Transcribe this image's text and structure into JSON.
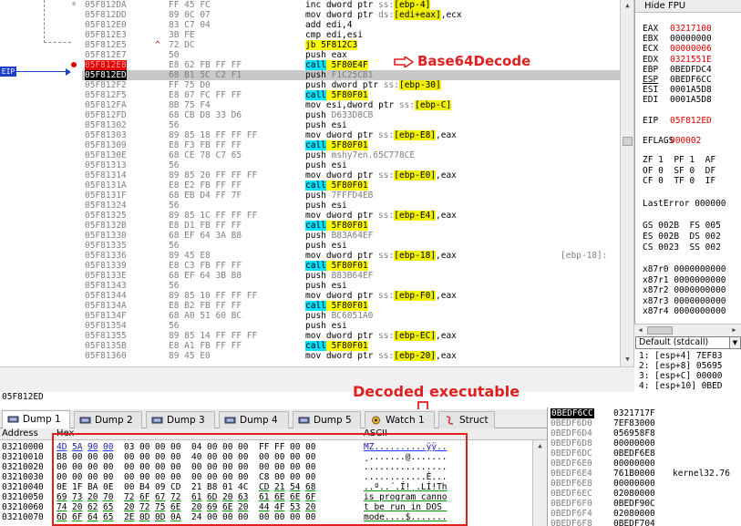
{
  "disasm": {
    "rows": [
      {
        "addr": "05F812DA",
        "bytes": "FF 45 FC",
        "ins": [
          [
            "inc dword ptr ",
            ""
          ],
          [
            "ss:",
            "seg"
          ],
          [
            "[ebp-4]",
            "mem"
          ]
        ],
        "mark": "",
        "style": ""
      },
      {
        "addr": "05F812DD",
        "bytes": "89 0C 07",
        "ins": [
          [
            "mov dword ptr ",
            ""
          ],
          [
            "ds:",
            "seg"
          ],
          [
            "[edi+eax]",
            "mem"
          ],
          [
            ",ecx",
            ""
          ]
        ],
        "mark": "",
        "style": ""
      },
      {
        "addr": "05F812E0",
        "bytes": "83 C7 04",
        "ins": [
          [
            "add edi,4",
            ""
          ]
        ],
        "mark": "",
        "style": ""
      },
      {
        "addr": "05F812E3",
        "bytes": "3B FE",
        "ins": [
          [
            "cmp edi,esi",
            ""
          ]
        ],
        "mark": "",
        "style": ""
      },
      {
        "addr": "05F812E5",
        "bytes": "72 DC",
        "ins": [
          [
            "jb",
            "jmp"
          ],
          [
            " 5F812C3",
            "tgt"
          ]
        ],
        "mark": "^",
        "style": ""
      },
      {
        "addr": "05F812E7",
        "bytes": "50",
        "ins": [
          [
            "push eax",
            ""
          ]
        ],
        "mark": "",
        "style": ""
      },
      {
        "addr": "05F812E8",
        "bytes": "E8 62 FB FF FF",
        "ins": [
          [
            "call",
            "call"
          ],
          [
            " 5F80E4F",
            "tgt"
          ]
        ],
        "mark": "",
        "style": "red"
      },
      {
        "addr": "05F812ED",
        "bytes": "68 B1 5C C2 F1",
        "ins": [
          [
            "push ",
            ""
          ],
          [
            "F1C25CB1",
            "gray"
          ]
        ],
        "mark": "",
        "style": "black hl"
      },
      {
        "addr": "05F812F2",
        "bytes": "FF 75 D0",
        "ins": [
          [
            "push dword ptr ",
            ""
          ],
          [
            "ss:",
            "seg"
          ],
          [
            "[ebp-30]",
            "mem"
          ]
        ],
        "mark": "",
        "style": ""
      },
      {
        "addr": "05F812F5",
        "bytes": "E8 07 FC FF FF",
        "ins": [
          [
            "call",
            "call"
          ],
          [
            " 5F80F01",
            "tgt"
          ]
        ],
        "mark": "",
        "style": ""
      },
      {
        "addr": "05F812FA",
        "bytes": "8B 75 F4",
        "ins": [
          [
            "mov esi,dword ptr ",
            ""
          ],
          [
            "ss:",
            "seg"
          ],
          [
            "[ebp-C]",
            "mem"
          ]
        ],
        "mark": "",
        "style": ""
      },
      {
        "addr": "05F812FD",
        "bytes": "68 CB D8 33 D6",
        "ins": [
          [
            "push ",
            ""
          ],
          [
            "D633D8CB",
            "gray"
          ]
        ],
        "mark": "",
        "style": ""
      },
      {
        "addr": "05F81302",
        "bytes": "56",
        "ins": [
          [
            "push esi",
            ""
          ]
        ],
        "mark": "",
        "style": ""
      },
      {
        "addr": "05F81303",
        "bytes": "89 85 18 FF FF FF",
        "ins": [
          [
            "mov dword ptr ",
            ""
          ],
          [
            "ss:",
            "seg"
          ],
          [
            "[ebp-E8]",
            "mem"
          ],
          [
            ",eax",
            ""
          ]
        ],
        "mark": "",
        "style": ""
      },
      {
        "addr": "05F81309",
        "bytes": "E8 F3 FB FF FF",
        "ins": [
          [
            "call",
            "call"
          ],
          [
            " 5F80F01",
            "tgt"
          ]
        ],
        "mark": "",
        "style": ""
      },
      {
        "addr": "05F8130E",
        "bytes": "68 CE 78 C7 65",
        "ins": [
          [
            "push ",
            ""
          ],
          [
            "mshy7en.65C778CE",
            "gray"
          ]
        ],
        "mark": "",
        "style": ""
      },
      {
        "addr": "05F81313",
        "bytes": "56",
        "ins": [
          [
            "push esi",
            ""
          ]
        ],
        "mark": "",
        "style": ""
      },
      {
        "addr": "05F81314",
        "bytes": "89 85 20 FF FF FF",
        "ins": [
          [
            "mov dword ptr ",
            ""
          ],
          [
            "ss:",
            "seg"
          ],
          [
            "[ebp-E0]",
            "mem"
          ],
          [
            ",eax",
            ""
          ]
        ],
        "mark": "",
        "style": ""
      },
      {
        "addr": "05F8131A",
        "bytes": "E8 E2 FB FF FF",
        "ins": [
          [
            "call",
            "call"
          ],
          [
            " 5F80F01",
            "tgt"
          ]
        ],
        "mark": "",
        "style": ""
      },
      {
        "addr": "05F8131F",
        "bytes": "68 EB D4 FF 7F",
        "ins": [
          [
            "push ",
            ""
          ],
          [
            "7FFFD4EB",
            "gray"
          ]
        ],
        "mark": "",
        "style": ""
      },
      {
        "addr": "05F81324",
        "bytes": "56",
        "ins": [
          [
            "push esi",
            ""
          ]
        ],
        "mark": "",
        "style": ""
      },
      {
        "addr": "05F81325",
        "bytes": "89 85 1C FF FF FF",
        "ins": [
          [
            "mov dword ptr ",
            ""
          ],
          [
            "ss:",
            "seg"
          ],
          [
            "[ebp-E4]",
            "mem"
          ],
          [
            ",eax",
            ""
          ]
        ],
        "mark": "",
        "style": ""
      },
      {
        "addr": "05F8132B",
        "bytes": "E8 D1 FB FF FF",
        "ins": [
          [
            "call",
            "call"
          ],
          [
            " 5F80F01",
            "tgt"
          ]
        ],
        "mark": "",
        "style": ""
      },
      {
        "addr": "05F81330",
        "bytes": "68 EF 64 3A B8",
        "ins": [
          [
            "push ",
            ""
          ],
          [
            "B83A64EF",
            "gray"
          ]
        ],
        "mark": "",
        "style": ""
      },
      {
        "addr": "05F81335",
        "bytes": "56",
        "ins": [
          [
            "push esi",
            ""
          ]
        ],
        "mark": "",
        "style": ""
      },
      {
        "addr": "05F81336",
        "bytes": "89 45 E8",
        "ins": [
          [
            "mov dword ptr ",
            ""
          ],
          [
            "ss:",
            "seg"
          ],
          [
            "[ebp-18]",
            "mem"
          ],
          [
            ",eax",
            ""
          ]
        ],
        "mark": "",
        "style": "",
        "cmt": "[ebp-18]:"
      },
      {
        "addr": "05F81339",
        "bytes": "E8 C3 FB FF FF",
        "ins": [
          [
            "call",
            "call"
          ],
          [
            " 5F80F01",
            "tgt"
          ]
        ],
        "mark": "",
        "style": ""
      },
      {
        "addr": "05F8133E",
        "bytes": "68 EF 64 3B B8",
        "ins": [
          [
            "push ",
            ""
          ],
          [
            "B83B64EF",
            "gray"
          ]
        ],
        "mark": "",
        "style": ""
      },
      {
        "addr": "05F81343",
        "bytes": "56",
        "ins": [
          [
            "push esi",
            ""
          ]
        ],
        "mark": "",
        "style": ""
      },
      {
        "addr": "05F81344",
        "bytes": "89 85 10 FF FF FF",
        "ins": [
          [
            "mov dword ptr ",
            ""
          ],
          [
            "ss:",
            "seg"
          ],
          [
            "[ebp-F0]",
            "mem"
          ],
          [
            ",eax",
            ""
          ]
        ],
        "mark": "",
        "style": ""
      },
      {
        "addr": "05F8134A",
        "bytes": "E8 B2 FB FF FF",
        "ins": [
          [
            "call",
            "call"
          ],
          [
            " 5F80F01",
            "tgt"
          ]
        ],
        "mark": "",
        "style": ""
      },
      {
        "addr": "05F8134F",
        "bytes": "68 A0 51 60 BC",
        "ins": [
          [
            "push ",
            ""
          ],
          [
            "BC6051A0",
            "gray"
          ]
        ],
        "mark": "",
        "style": ""
      },
      {
        "addr": "05F81354",
        "bytes": "56",
        "ins": [
          [
            "push esi",
            ""
          ]
        ],
        "mark": "",
        "style": ""
      },
      {
        "addr": "05F81355",
        "bytes": "89 85 14 FF FF FF",
        "ins": [
          [
            "mov dword ptr ",
            ""
          ],
          [
            "ss:",
            "seg"
          ],
          [
            "[ebp-EC]",
            "mem"
          ],
          [
            ",eax",
            ""
          ]
        ],
        "mark": "",
        "style": ""
      },
      {
        "addr": "05F8135B",
        "bytes": "E8 A1 FB FF FF",
        "ins": [
          [
            "call",
            "call"
          ],
          [
            " 5F80F01",
            "tgt"
          ]
        ],
        "mark": "",
        "style": ""
      },
      {
        "addr": "05F81360",
        "bytes": "89 45 E0",
        "ins": [
          [
            "mov dword ptr ",
            ""
          ],
          [
            "ss:",
            "seg"
          ],
          [
            "[ebp-20]",
            "mem"
          ],
          [
            ",eax",
            ""
          ]
        ],
        "mark": "",
        "style": ""
      }
    ],
    "eip_label": "EIP",
    "annotation_base64": "Base64Decode"
  },
  "registers": {
    "header": "Hide FPU",
    "items": [
      {
        "name": "EAX",
        "value": "03217100",
        "red": true
      },
      {
        "name": "EBX",
        "value": "00000000",
        "red": false
      },
      {
        "name": "ECX",
        "value": "00000006",
        "red": true
      },
      {
        "name": "EDX",
        "value": "0321551E",
        "red": true
      },
      {
        "name": "EBP",
        "value": "0BEDFDC4",
        "red": false
      },
      {
        "name": "ESP",
        "value": "0BEDF6CC",
        "red": false,
        "ul": true
      },
      {
        "name": "ESI",
        "value": "0001A5D8",
        "red": false
      },
      {
        "name": "EDI",
        "value": "0001A5D8",
        "red": false
      },
      {
        "name": "",
        "value": "",
        "red": false
      },
      {
        "name": "EIP",
        "value": "05F812ED",
        "red": true
      },
      {
        "name": "",
        "value": "",
        "red": false
      },
      {
        "name": "EFLAGS",
        "value": "000002",
        "red": true
      }
    ],
    "flags": [
      "ZF 1  PF 1  AF",
      "OF 0  SF 0  DF",
      "CF 0  TF 0  IF"
    ],
    "lasterror": "LastError 000000",
    "segments": [
      "GS 002B  FS 005",
      "ES 002B  DS 002",
      "CS 0023  SS 002"
    ],
    "fpu": [
      "x87r0 0000000000",
      "x87r1 0000000000",
      "x87r2 0000000000",
      "x87r3 0000000000",
      "x87r4 0000000000"
    ]
  },
  "callconv": {
    "selected": "Default (stdcall)"
  },
  "stack_args": [
    "1: [esp+4] 7EF83",
    "2: [esp+8] 05695",
    "3: [esp+C] 00000",
    "4: [esp+10] 0BED"
  ],
  "status": {
    "text": "05F812ED"
  },
  "annotation_decoded": "Decoded executable",
  "dump": {
    "tabs": [
      {
        "label": "Dump 1",
        "active": true
      },
      {
        "label": "Dump 2",
        "active": false
      },
      {
        "label": "Dump 3",
        "active": false
      },
      {
        "label": "Dump 4",
        "active": false
      },
      {
        "label": "Dump 5",
        "active": false
      },
      {
        "label": "Watch 1",
        "active": false
      },
      {
        "label": "Struct",
        "active": false
      }
    ],
    "headers": {
      "address": "Address",
      "hex": "Hex",
      "ascii": "ASCII"
    },
    "rows": [
      {
        "addr": "03210000",
        "hex": [
          "4D",
          "5A",
          "90",
          "00",
          "03",
          "00",
          "00",
          "00",
          "04",
          "00",
          "00",
          "00",
          "FF",
          "FF",
          "00",
          "00"
        ],
        "ascii": "MZ..........ÿÿ.."
      },
      {
        "addr": "03210010",
        "hex": [
          "B8",
          "00",
          "00",
          "00",
          "00",
          "00",
          "00",
          "00",
          "40",
          "00",
          "00",
          "00",
          "00",
          "00",
          "00",
          "00"
        ],
        "ascii": "¸.......@......."
      },
      {
        "addr": "03210020",
        "hex": [
          "00",
          "00",
          "00",
          "00",
          "00",
          "00",
          "00",
          "00",
          "00",
          "00",
          "00",
          "00",
          "00",
          "00",
          "00",
          "00"
        ],
        "ascii": "................"
      },
      {
        "addr": "03210030",
        "hex": [
          "00",
          "00",
          "00",
          "00",
          "00",
          "00",
          "00",
          "00",
          "00",
          "00",
          "00",
          "00",
          "C8",
          "00",
          "00",
          "00"
        ],
        "ascii": "............È..."
      },
      {
        "addr": "03210040",
        "hex": [
          "0E",
          "1F",
          "BA",
          "0E",
          "00",
          "B4",
          "09",
          "CD",
          "21",
          "B8",
          "01",
          "4C",
          "CD",
          "21",
          "54",
          "68"
        ],
        "ascii": "..º..´.Í!¸.LÍ!Th"
      },
      {
        "addr": "03210050",
        "hex": [
          "69",
          "73",
          "20",
          "70",
          "72",
          "6F",
          "67",
          "72",
          "61",
          "6D",
          "20",
          "63",
          "61",
          "6E",
          "6E",
          "6F"
        ],
        "ascii": "is program canno"
      },
      {
        "addr": "03210060",
        "hex": [
          "74",
          "20",
          "62",
          "65",
          "20",
          "72",
          "75",
          "6E",
          "20",
          "69",
          "6E",
          "20",
          "44",
          "4F",
          "53",
          "20"
        ],
        "ascii": "t be run in DOS "
      },
      {
        "addr": "03210070",
        "hex": [
          "6D",
          "6F",
          "64",
          "65",
          "2E",
          "0D",
          "0D",
          "0A",
          "24",
          "00",
          "00",
          "00",
          "00",
          "00",
          "00",
          "00"
        ],
        "ascii": "mode....$......."
      }
    ]
  },
  "stack": [
    {
      "addr": "0BEDF6CC",
      "val": "0321717F",
      "cmt": "",
      "top": true
    },
    {
      "addr": "0BEDF6D0",
      "val": "7EF83000",
      "cmt": ""
    },
    {
      "addr": "0BEDF6D4",
      "val": "056958F8",
      "cmt": ""
    },
    {
      "addr": "0BEDF6D8",
      "val": "00000000",
      "cmt": ""
    },
    {
      "addr": "0BEDF6DC",
      "val": "0BEDF6E8",
      "cmt": ""
    },
    {
      "addr": "0BEDF6E0",
      "val": "00000000",
      "cmt": ""
    },
    {
      "addr": "0BEDF6E4",
      "val": "761B0000",
      "cmt": "kernel32.76"
    },
    {
      "addr": "0BEDF6E8",
      "val": "00000000",
      "cmt": ""
    },
    {
      "addr": "0BEDF6EC",
      "val": "02080000",
      "cmt": ""
    },
    {
      "addr": "0BEDF6F0",
      "val": "0BEDF90C",
      "cmt": ""
    },
    {
      "addr": "0BEDF6F4",
      "val": "02080000",
      "cmt": ""
    },
    {
      "addr": "0BEDF6F8",
      "val": "0BEDF704",
      "cmt": ""
    }
  ]
}
